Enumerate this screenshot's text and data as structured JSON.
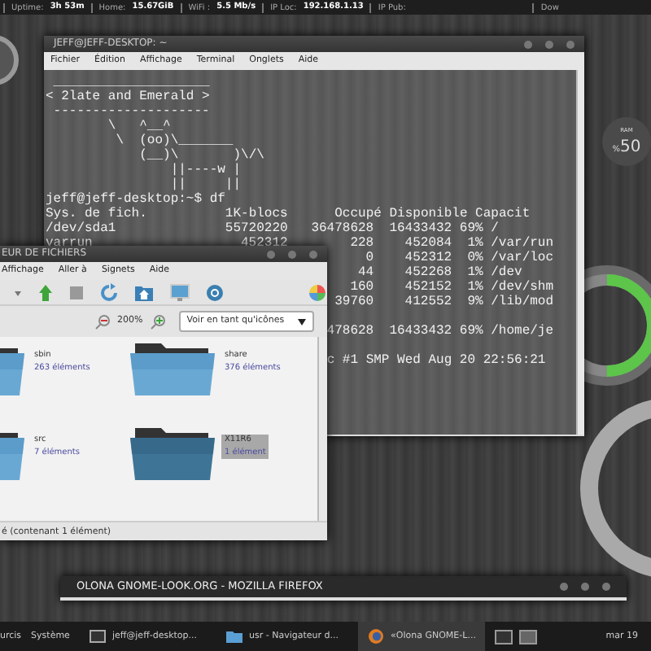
{
  "top_bar": {
    "segments": [
      {
        "label": "Uptime:",
        "value": "3h 53m"
      },
      {
        "label": "Home:",
        "value": "15.67GiB"
      },
      {
        "label": "WiFi :",
        "value": "5.5 Mb/s"
      },
      {
        "label": "IP Loc:",
        "value": "192.168.1.13"
      },
      {
        "label": "IP Pub:"
      },
      {
        "label": "Dow"
      }
    ]
  },
  "ram_widget": {
    "label": "RAM",
    "unit": "%",
    "value": "50"
  },
  "ring_gauge": {
    "level": 0.5
  },
  "terminal": {
    "title": "JEFF@JEFF-DESKTOP: ~",
    "menu": [
      "Fichier",
      "Édition",
      "Affichage",
      "Terminal",
      "Onglets",
      "Aide"
    ],
    "lines": [
      {
        "kind": "text",
        "text": " ____________________"
      },
      {
        "kind": "text",
        "text": "< 2late and Emerald >"
      },
      {
        "kind": "text",
        "text": " --------------------"
      },
      {
        "kind": "text",
        "text": "        \\   ^__^"
      },
      {
        "kind": "text",
        "text": "         \\  (oo)\\_______"
      },
      {
        "kind": "text",
        "text": "            (__)\\       )\\/\\"
      },
      {
        "kind": "text",
        "text": "                ||----w |"
      },
      {
        "kind": "text",
        "text": "                ||     ||"
      },
      {
        "kind": "text",
        "text": "jeff@jeff-desktop:~$ df"
      },
      {
        "kind": "text",
        "text": "Sys. de fich.          1K-blocs      Occupé Disponible Capacit"
      },
      {
        "kind": "row",
        "cells": [
          "/dev/sda1",
          "55720220",
          "36478628",
          "16433432",
          "69%",
          "/"
        ]
      },
      {
        "kind": "row",
        "cells": [
          "varrun",
          "452312",
          "228",
          "452084",
          "1%",
          "/var/run"
        ]
      },
      {
        "kind": "row",
        "cells": [
          "0",
          "452312",
          "0%",
          "/var/loc"
        ]
      },
      {
        "kind": "row",
        "cells": [
          "44",
          "452268",
          "1%",
          "/dev"
        ]
      },
      {
        "kind": "row",
        "cells": [
          "160",
          "452152",
          "1%",
          "/dev/shm"
        ]
      },
      {
        "kind": "row",
        "cells": [
          "39760",
          "412552",
          "9%",
          "/lib/mod"
        ]
      },
      {
        "kind": "blank"
      },
      {
        "kind": "row",
        "cells": [
          "478628",
          "16433432",
          "69%",
          "/home/je"
        ]
      },
      {
        "kind": "blank"
      },
      {
        "kind": "tail",
        "text": "c #1 SMP Wed Aug 20 22:56:21"
      }
    ]
  },
  "file_manager": {
    "title": "EUR DE FICHIERS",
    "menu": [
      "Affichage",
      "Aller à",
      "Signets",
      "Aide"
    ],
    "zoom": "200%",
    "view_select": "Voir en tant qu'icônes",
    "items": [
      {
        "name": "sbin",
        "count": "263 éléments",
        "selected": false
      },
      {
        "name": "share",
        "count": "376 éléments",
        "selected": false
      },
      {
        "name": "src",
        "count": "7 éléments",
        "selected": false
      },
      {
        "name": "X11R6",
        "count": "1 élément",
        "selected": true
      }
    ],
    "status": "é (contenant 1 élément)"
  },
  "browser_window": {
    "title": "OLONA GNOME-LOOK.ORG - MOZILLA FIREFOX"
  },
  "taskbar": {
    "menus": [
      "urcis",
      "Système"
    ],
    "tasks": [
      {
        "kind": "terminal",
        "label": "jeff@jeff-desktop...",
        "selected": false
      },
      {
        "kind": "folder",
        "label": "usr - Navigateur d...",
        "selected": false
      },
      {
        "kind": "browser",
        "label": "«Olona GNOME-L...",
        "selected": true
      }
    ],
    "workspaces": [
      {
        "selected": false
      },
      {
        "selected": true
      }
    ],
    "clock": "mar 19"
  }
}
